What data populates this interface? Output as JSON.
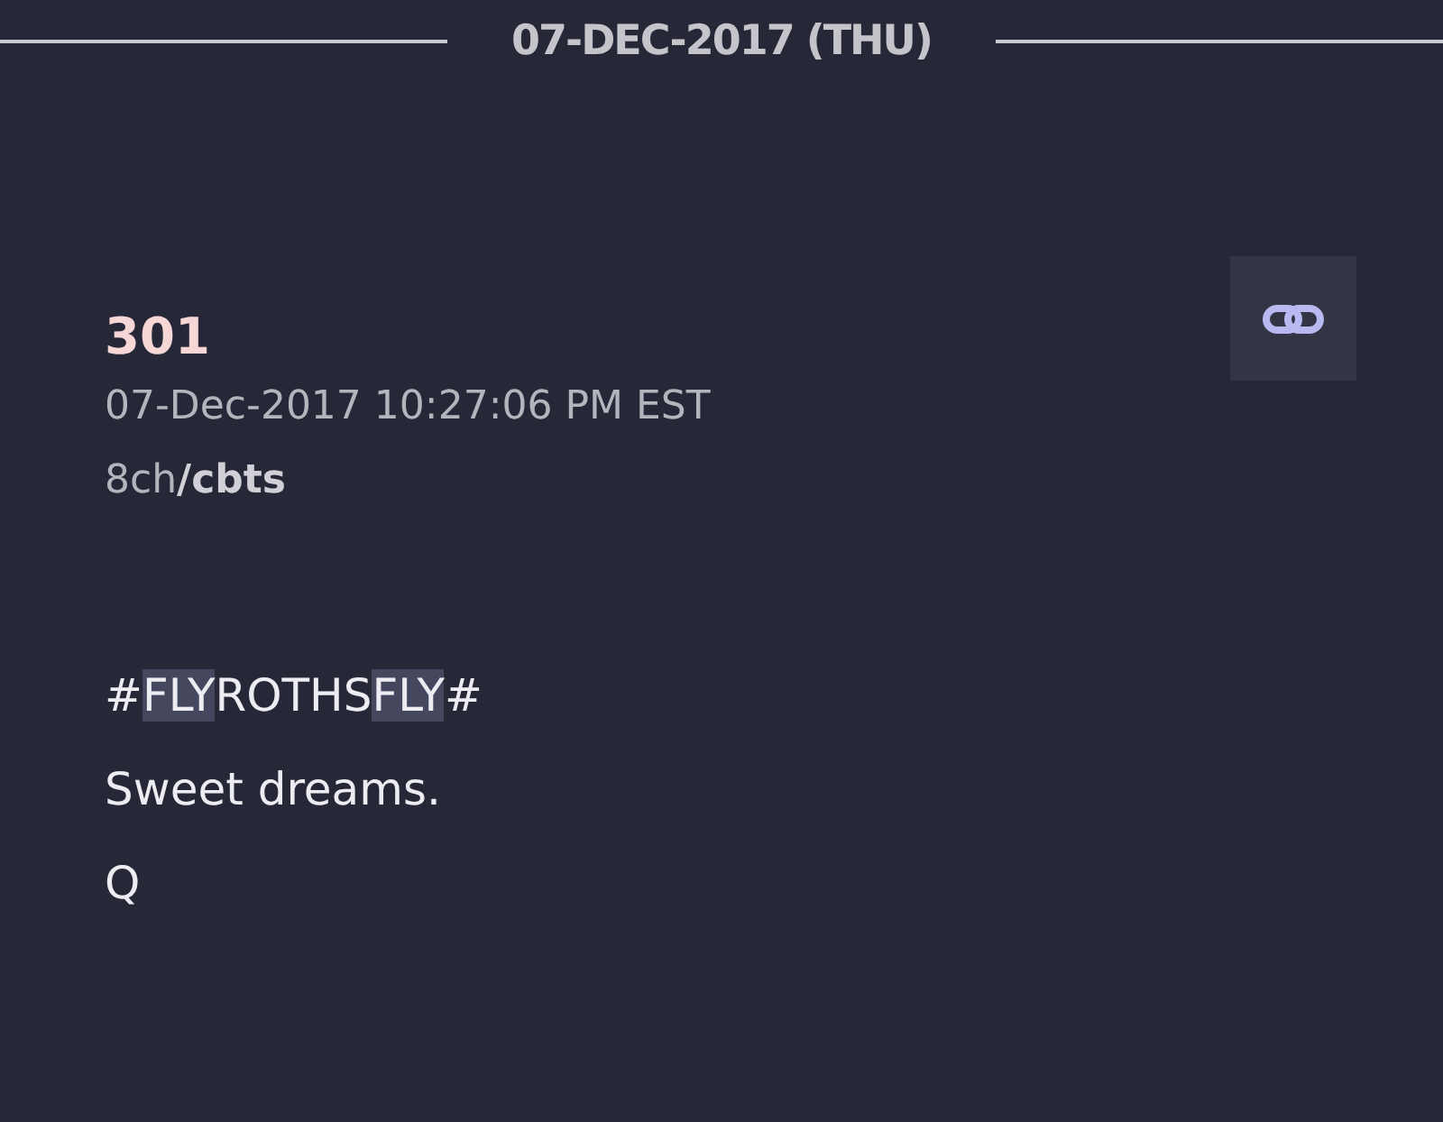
{
  "date_header": "07-DEC-2017 (THU)",
  "post": {
    "number": "301",
    "timestamp": "07-Dec-2017 10:27:06 PM EST",
    "source": "8ch**/cbts**",
    "lines": [
      {
        "segments": [
          {
            "text": "#",
            "highlight": false
          },
          {
            "text": "FLY",
            "highlight": true
          },
          {
            "text": "ROTHS",
            "highlight": false
          },
          {
            "text": "FLY",
            "highlight": true
          },
          {
            "text": "#",
            "highlight": false
          }
        ]
      },
      {
        "segments": [
          {
            "text": "Sweet dreams.",
            "highlight": false
          }
        ]
      },
      {
        "segments": [
          {
            "text": "Q",
            "highlight": false
          }
        ]
      }
    ]
  }
}
